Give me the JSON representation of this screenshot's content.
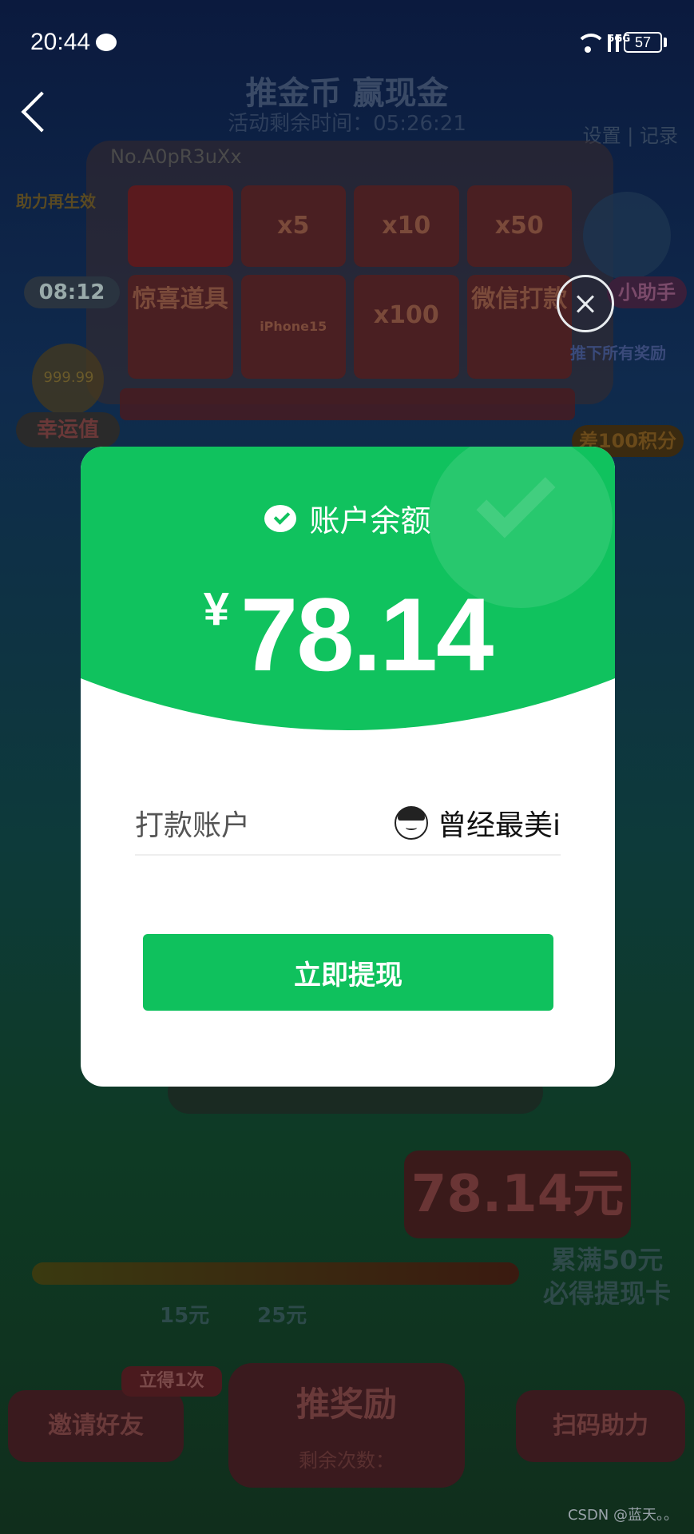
{
  "status_bar": {
    "time": "20:44",
    "network_a": "5G",
    "network_b": "5G",
    "battery": "57"
  },
  "background": {
    "title": "推金币 赢现金",
    "timer": "活动剩余时间：05:26:21",
    "settings": "设置 | 记录",
    "machine_no": "No.A0pR3uXx",
    "prizes": [
      "x5",
      "x10",
      "x50",
      "惊喜道具",
      "iPhone15",
      "x100",
      "微信打款"
    ],
    "left_badge": "助力再生效",
    "left_timer": "08:12",
    "luck_value": "999.99",
    "luck_label": "幸运值",
    "helper_label": "小助手",
    "collect_all": "推下所有奖励",
    "points_label": "差100积分",
    "amount_bubble": "78.14元",
    "accum_line1": "累满50元",
    "accum_line2": "必得提现卡",
    "progress_15": "15元",
    "progress_25": "25元",
    "invite_label": "邀请好友",
    "invite_tag": "立得1次",
    "push_label": "推奖励",
    "remaining_label": "剩余次数：",
    "scan_label": "扫码助力"
  },
  "modal": {
    "balance_label": "账户余额",
    "currency": "¥",
    "amount": "78.14",
    "account_label": "打款账户",
    "account_name": "曾经最美i",
    "withdraw_label": "立即提现",
    "accent": "#0fc15d"
  },
  "watermark": "CSDN @蓝天。。"
}
